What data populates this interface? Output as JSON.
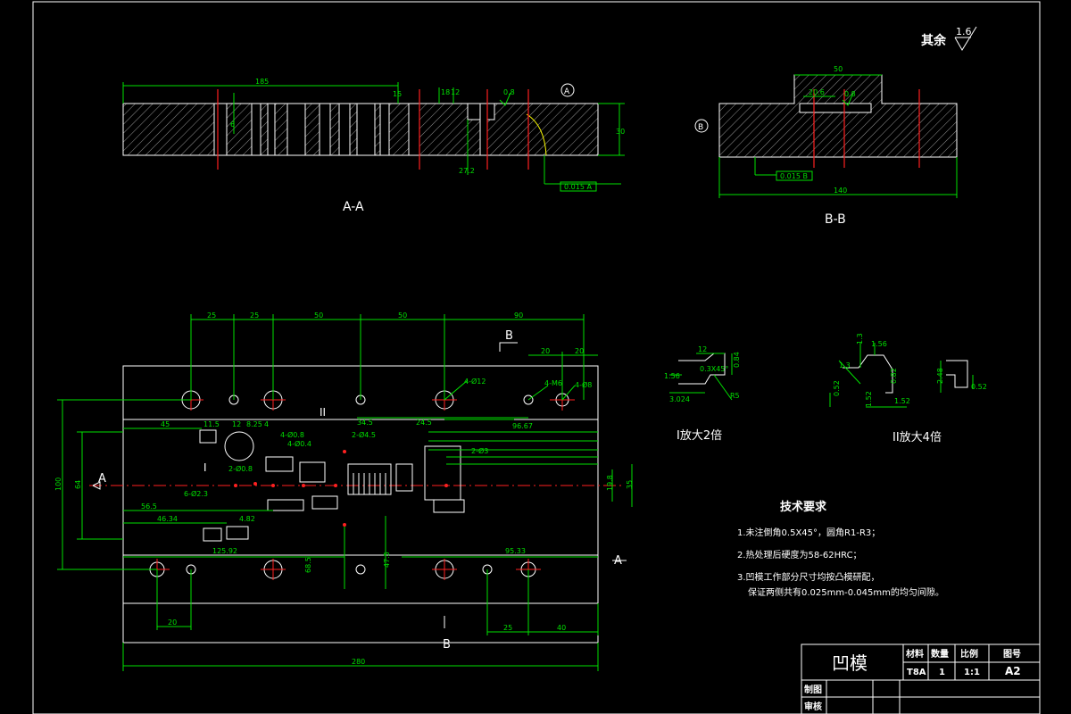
{
  "drawing": {
    "surface_note": "其余",
    "surface_roughness": "1.6",
    "section_aa": {
      "caption": "A-A",
      "dims": [
        "185",
        "15",
        "18",
        "12",
        "6",
        "30",
        "27.2",
        "0.8"
      ],
      "cut_marker": "A",
      "tolerance": "0.015 A"
    },
    "section_bb": {
      "caption": "B-B",
      "dims": [
        "50",
        "20.6",
        "0.8",
        "140"
      ],
      "datum": "B",
      "tolerance": "0.015 B"
    },
    "plan_view": {
      "top_dims": [
        "25",
        "25",
        "50",
        "50",
        "90",
        "20",
        "20"
      ],
      "bottom_dims": [
        "20",
        "25",
        "40",
        "280"
      ],
      "left_dims": [
        "100",
        "64"
      ],
      "right_dims": [
        "19.8",
        "35"
      ],
      "row_dims": [
        "45",
        "11.5",
        "12",
        "8.25",
        "4",
        "34.5",
        "24.5",
        "96.67",
        "56.5",
        "46.34",
        "4.82",
        "125.92",
        "95.33",
        "68.5",
        "47.5"
      ],
      "callouts": [
        "4-Ø12",
        "4-M6",
        "4-Ø8",
        "2-Ø4.5",
        "2-Ø3",
        "4-Ø0.8",
        "4-Ø0.4",
        "2-Ø0.8",
        "6-Ø2.3"
      ],
      "section_labels": [
        "A",
        "A",
        "B",
        "B"
      ],
      "detail_labels": [
        "I",
        "II"
      ]
    },
    "detail_1": {
      "caption": "I放大2倍",
      "dims": [
        "12",
        "0.3X45°",
        "0.84",
        "1.56",
        "3.024",
        "R5"
      ]
    },
    "detail_2": {
      "caption": "II放大4倍",
      "dims": [
        "1.3",
        "1.56",
        "1.3",
        "0.52",
        "1.52",
        "0.82",
        "1.52",
        "2.48",
        "0.52"
      ]
    }
  },
  "tech_requirements": {
    "title": "技术要求",
    "items": [
      "1.未注倒角0.5X45°，圆角R1-R3；",
      "2.热处理后硬度为58-62HRC；",
      "3.凹模工作部分尺寸均按凸模研配，"
    ],
    "item3_line2": "保证两侧共有0.025mm-0.045mm的均匀间隙。"
  },
  "title_block": {
    "part_name": "凹模",
    "headers": [
      "材料",
      "数量",
      "比例",
      "图号"
    ],
    "values": [
      "T8A",
      "1",
      "1:1",
      "A2"
    ],
    "roles": [
      "制图",
      "审核"
    ]
  },
  "colors": {
    "background": "#000000",
    "outline": "#ffffff",
    "dimension": "#00ff00",
    "centerline": "#ff0000",
    "hatch": "#ffffff"
  }
}
